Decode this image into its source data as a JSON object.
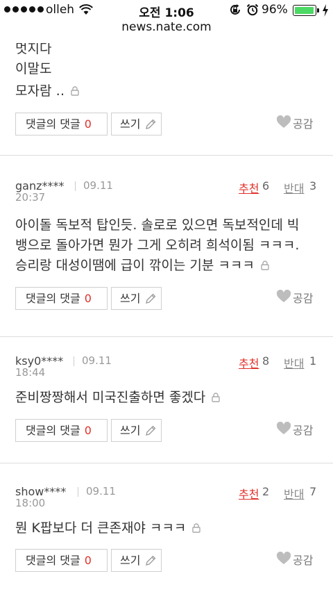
{
  "status_bar": {
    "carrier": "olleh",
    "time": "오전 1:06",
    "battery": "96%",
    "battery_level": 0.96,
    "url": "news.nate.com"
  },
  "colors": {
    "accent_red": "#e0312b",
    "battery_green": "#4cd964"
  },
  "first_comment": {
    "lines": [
      "멋지다",
      "이말도",
      "모자람 ‥"
    ],
    "reply_label": "댓글의 댓글",
    "reply_count": "0",
    "write_label": "쓰기",
    "like_label": "공감"
  },
  "comments": [
    {
      "user": "ganz****",
      "date": "09.11",
      "time": "20:37",
      "recommend_label": "추천",
      "recommend_count": "6",
      "oppose_label": "반대",
      "oppose_count": "3",
      "lines": [
        "아이돌 독보적 탑인듯. 솔로로 있으면 독보적인데 빅",
        "뱅으로 돌아가면 뭔가 그게 오히려 희석이됨 ㅋㅋㅋ.",
        "승리랑 대성이땜에 급이 깎이는 기분 ㅋㅋㅋ"
      ],
      "reply_label": "댓글의 댓글",
      "reply_count": "0",
      "write_label": "쓰기",
      "like_label": "공감"
    },
    {
      "user": "ksy0****",
      "date": "09.11",
      "time": "18:44",
      "recommend_label": "추천",
      "recommend_count": "8",
      "oppose_label": "반대",
      "oppose_count": "1",
      "lines": [
        "준비짱짱해서 미국진출하면 좋겠다"
      ],
      "reply_label": "댓글의 댓글",
      "reply_count": "0",
      "write_label": "쓰기",
      "like_label": "공감"
    },
    {
      "user": "show****",
      "date": "09.11",
      "time": "18:00",
      "recommend_label": "추천",
      "recommend_count": "2",
      "oppose_label": "반대",
      "oppose_count": "7",
      "lines": [
        "뭔 K팝보다 더 큰존재야 ㅋㅋㅋ"
      ],
      "reply_label": "댓글의 댓글",
      "reply_count": "0",
      "write_label": "쓰기",
      "like_label": "공감"
    }
  ]
}
